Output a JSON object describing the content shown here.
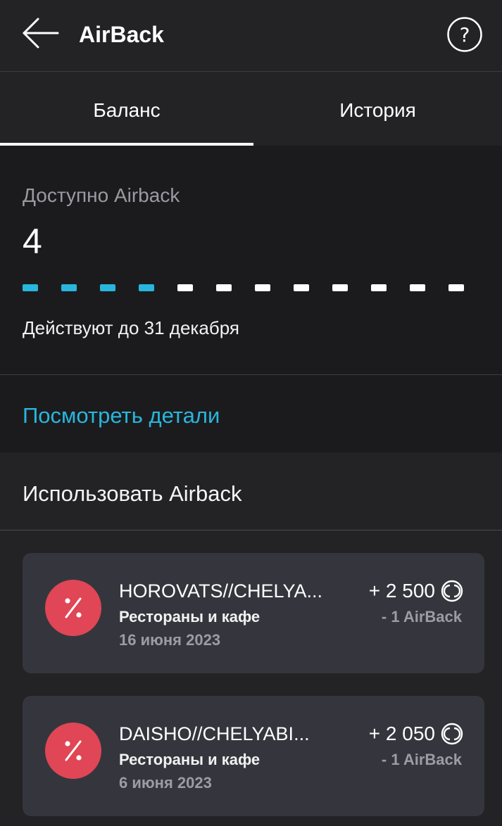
{
  "header": {
    "title": "AirBack",
    "back_icon": "arrow-left-icon",
    "help_icon": "question-circle-icon"
  },
  "tabs": [
    {
      "label": "Баланс",
      "active": true
    },
    {
      "label": "История",
      "active": false
    }
  ],
  "balance": {
    "available_label": "Доступно Airback",
    "available_value": "4",
    "progress_filled": 4,
    "progress_total": 12,
    "valid_until": "Действуют до 31 декабря"
  },
  "details_link": "Посмотреть детали",
  "use_section_title": "Использовать Airback",
  "transactions": [
    {
      "merchant": "HOROVATS//CHELYA...",
      "category": "Рестораны и кафе",
      "date": "16 июня 2023",
      "amount": "+ 2 500",
      "airback": "- 1 AirBack",
      "icon": "percent-icon"
    },
    {
      "merchant": "DAISHO//CHELYABI...",
      "category": "Рестораны и кафе",
      "date": "6 июня 2023",
      "amount": "+ 2 050",
      "airback": "- 1 AirBack",
      "icon": "percent-icon"
    }
  ],
  "colors": {
    "accent": "#29b6dc",
    "progress_empty": "#ffffff",
    "category_icon_bg": "#e04655",
    "card_bg": "#35363d",
    "panel_bg": "#1b1b1e",
    "background": "#232326"
  }
}
